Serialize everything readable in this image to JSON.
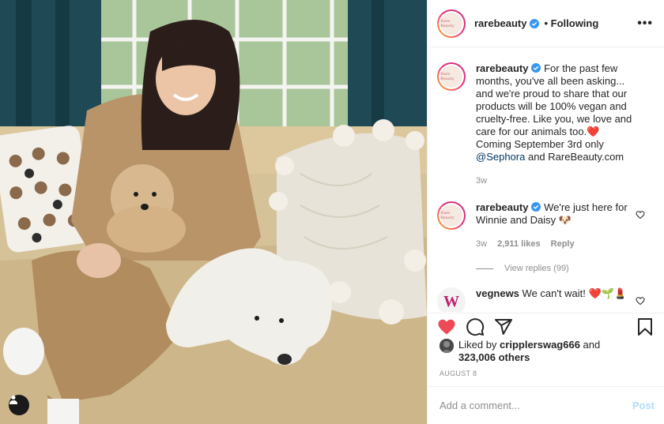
{
  "post": {
    "username": "rarebeauty",
    "following_label": "• Following",
    "more_label": "•••",
    "avatar_text": "Rare Beauty"
  },
  "comments": [
    {
      "username": "rarebeauty",
      "text_a": " For the past few months, you've all been asking... and we're proud to share that our products will be 100% vegan and cruelty-free. Like you, we love and care for our animals too.",
      "emoji_a": "❤️",
      "text_b": "Coming September 3rd only",
      "mention": "@Sephora",
      "text_c": " and RareBeauty.com",
      "time": "3w"
    },
    {
      "username": "rarebeauty",
      "text": " We're just here for Winnie and Daisy",
      "emoji": "🐶",
      "time": "3w",
      "likes": "2,911 likes",
      "reply_label": "Reply",
      "view_replies": "View replies (99)"
    },
    {
      "username": "vegnews",
      "text": " We can't wait!",
      "emoji": "❤️🌱💄"
    }
  ],
  "likes": {
    "prefix": "Liked by ",
    "user": "cripplerswag666",
    "middle": " and",
    "count": "323,006 others"
  },
  "date": "AUGUST 8",
  "add_comment": {
    "placeholder": "Add a comment...",
    "post_label": "Post"
  },
  "colors": {
    "like_red": "#ed4956",
    "verified_blue": "#3897f0",
    "post_disabled": "#b2dffc"
  },
  "icons": [
    "verified-badge-icon",
    "heart-icon",
    "comment-icon",
    "share-icon",
    "bookmark-icon",
    "user-tag-icon",
    "more-icon"
  ]
}
